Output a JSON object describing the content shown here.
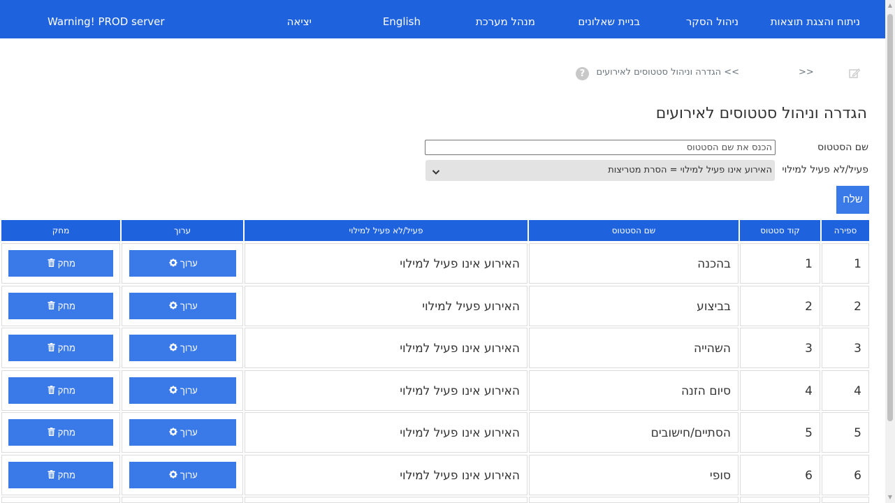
{
  "nav": {
    "items": [
      {
        "label": "ניתוח והצגת תוצאות"
      },
      {
        "label": "ניהול הסקר"
      },
      {
        "label": "בניית שאלונים"
      },
      {
        "label": "מנהל מערכת"
      },
      {
        "label": "English"
      },
      {
        "label": "יציאה"
      }
    ],
    "warning": "Warning! PROD server"
  },
  "breadcrumb": {
    "separator": ">>",
    "current": ">> הגדרה וניהול סטטוסים לאירועים",
    "help": "?"
  },
  "page_title": "הגדרה וניהול סטטוסים לאירועים",
  "form": {
    "name_label": "שם הסטטוס",
    "name_placeholder": "הכנס את שם הסטטוס",
    "active_label": "פעיל/לא פעיל למילוי",
    "active_selected": "האירוע אינו פעיל למילוי = הסרת מטריצות",
    "submit_label": "שלח"
  },
  "table": {
    "headers": {
      "num": "ספירה",
      "code": "קוד סטטוס",
      "name": "שם הסטטוס",
      "active": "פעיל/לא פעיל למילוי",
      "edit": "ערוך",
      "delete": "מחק"
    },
    "edit_label": "ערוך",
    "delete_label": "מחק",
    "rows": [
      {
        "num": "1",
        "code": "1",
        "name": "בהכנה",
        "active": "האירוע אינו פעיל למילוי"
      },
      {
        "num": "2",
        "code": "2",
        "name": "בביצוע",
        "active": "האירוע פעיל למילוי"
      },
      {
        "num": "3",
        "code": "3",
        "name": "השהייה",
        "active": "האירוע אינו פעיל למילוי"
      },
      {
        "num": "4",
        "code": "4",
        "name": "סיום הזנה",
        "active": "האירוע אינו פעיל למילוי"
      },
      {
        "num": "5",
        "code": "5",
        "name": "הסתיים/חישובים",
        "active": "האירוע אינו פעיל למילוי"
      },
      {
        "num": "6",
        "code": "6",
        "name": "סופי",
        "active": "האירוע אינו פעיל למילוי"
      }
    ]
  },
  "colors": {
    "primary": "#1e62de",
    "button": "#3a79e8"
  }
}
